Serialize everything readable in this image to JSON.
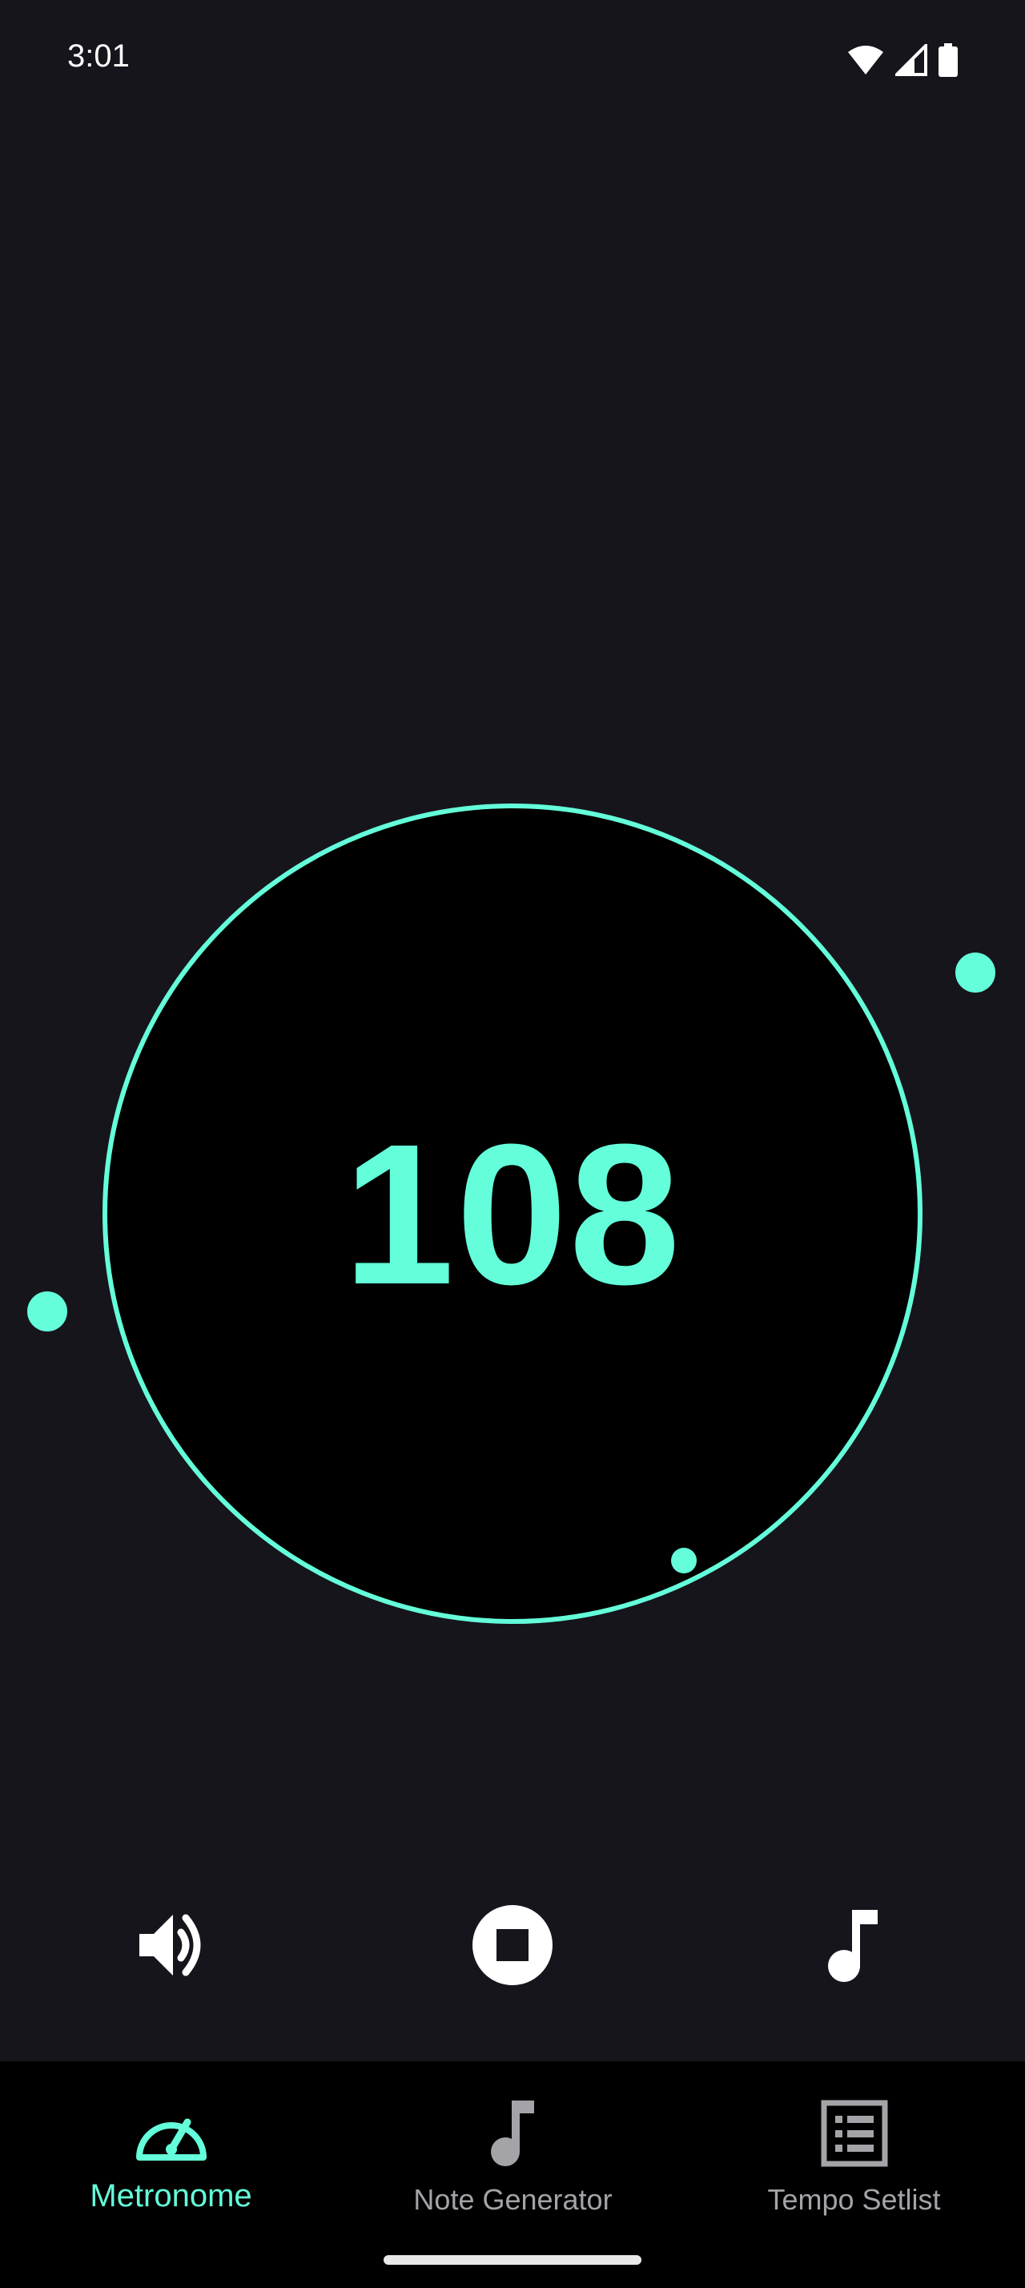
{
  "status_bar": {
    "time": "3:01",
    "icons": [
      "wifi-icon",
      "cell-signal-icon",
      "battery-icon"
    ]
  },
  "metronome": {
    "bpm": "108",
    "accent_color": "#64ffda",
    "beat_dots": 3
  },
  "controls": {
    "volume_icon": "volume-up-icon",
    "stop_icon": "stop-circle-icon",
    "note_icon": "music-note-icon"
  },
  "bottom_nav": {
    "items": [
      {
        "label": "Metronome",
        "icon": "speedometer-icon",
        "active": true
      },
      {
        "label": "Note Generator",
        "icon": "music-note-icon",
        "active": false
      },
      {
        "label": "Tempo Setlist",
        "icon": "list-icon",
        "active": false
      }
    ]
  },
  "colors": {
    "background": "#17151c",
    "accent": "#64ffda",
    "nav_background": "#000000",
    "inactive_label": "#a3a3a8"
  }
}
